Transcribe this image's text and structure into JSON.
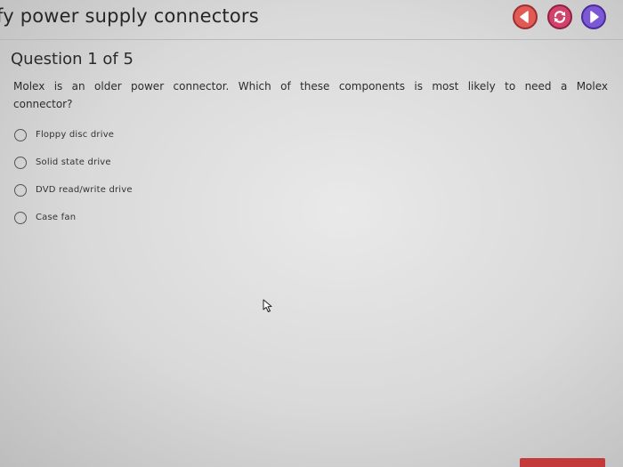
{
  "header": {
    "title": "fy power supply connectors",
    "prev_icon": "chevron-left-icon",
    "reload_icon": "reload-icon",
    "next_icon": "chevron-right-icon"
  },
  "question": {
    "title": "Question 1 of 5",
    "text": "Molex is an older power connector. Which of these components is most likely to need a Molex connector?"
  },
  "options": [
    {
      "label": "Floppy disc drive",
      "selected": false
    },
    {
      "label": "Solid state drive",
      "selected": false
    },
    {
      "label": "DVD read/write drive",
      "selected": false
    },
    {
      "label": "Case fan",
      "selected": false
    }
  ],
  "colors": {
    "prev": "#e15a53",
    "reload": "#d2426a",
    "next": "#7d58d6"
  }
}
